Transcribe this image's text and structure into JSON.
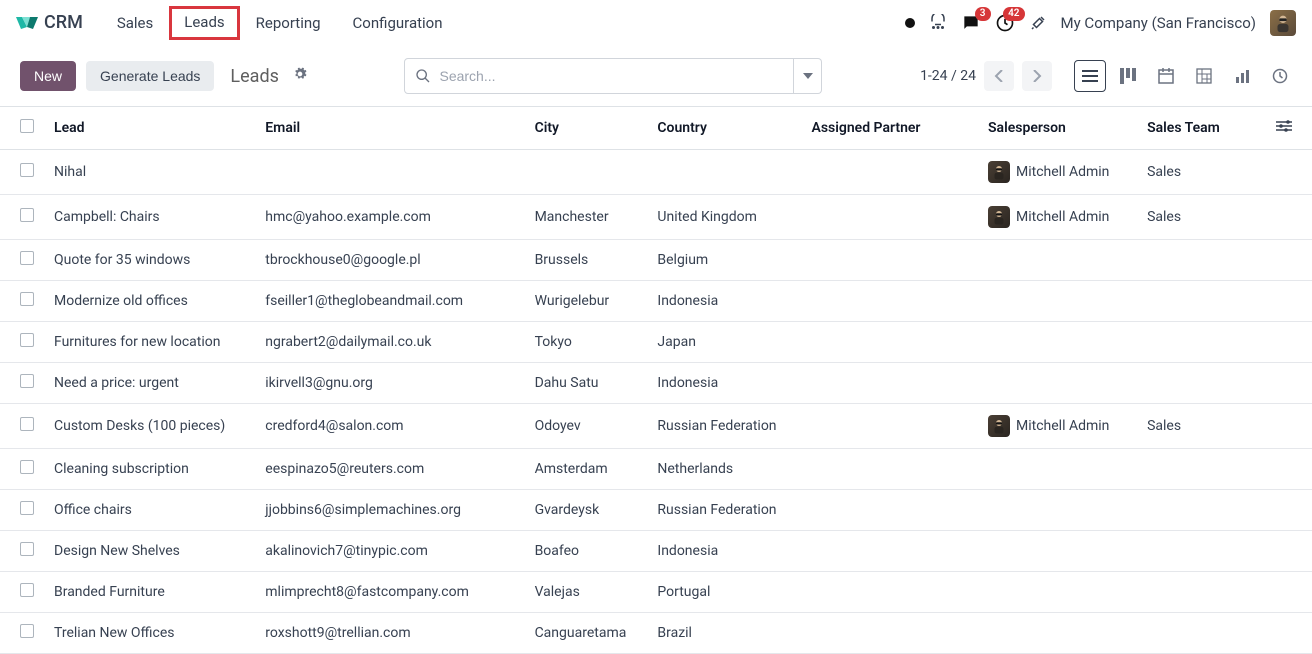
{
  "app": {
    "title": "CRM"
  },
  "nav": {
    "items": [
      {
        "label": "Sales"
      },
      {
        "label": "Leads"
      },
      {
        "label": "Reporting"
      },
      {
        "label": "Configuration"
      }
    ]
  },
  "topbar": {
    "messages_badge": "3",
    "activities_badge": "42",
    "company": "My Company (San Francisco)"
  },
  "controls": {
    "new_label": "New",
    "generate_label": "Generate Leads",
    "breadcrumb": "Leads",
    "search_placeholder": "Search...",
    "pager": "1-24 / 24"
  },
  "table": {
    "headers": {
      "lead": "Lead",
      "email": "Email",
      "city": "City",
      "country": "Country",
      "partner": "Assigned Partner",
      "salesperson": "Salesperson",
      "team": "Sales Team"
    },
    "rows": [
      {
        "lead": "Nihal",
        "email": "",
        "city": "",
        "country": "",
        "partner": "",
        "salesperson": "Mitchell Admin",
        "team": "Sales"
      },
      {
        "lead": "Campbell: Chairs",
        "email": "hmc@yahoo.example.com",
        "city": "Manchester",
        "country": "United Kingdom",
        "partner": "",
        "salesperson": "Mitchell Admin",
        "team": "Sales"
      },
      {
        "lead": "Quote for 35 windows",
        "email": "tbrockhouse0@google.pl",
        "city": "Brussels",
        "country": "Belgium",
        "partner": "",
        "salesperson": "",
        "team": ""
      },
      {
        "lead": "Modernize old offices",
        "email": "fseiller1@theglobeandmail.com",
        "city": "Wurigelebur",
        "country": "Indonesia",
        "partner": "",
        "salesperson": "",
        "team": ""
      },
      {
        "lead": "Furnitures for new location",
        "email": "ngrabert2@dailymail.co.uk",
        "city": "Tokyo",
        "country": "Japan",
        "partner": "",
        "salesperson": "",
        "team": ""
      },
      {
        "lead": "Need a price: urgent",
        "email": "ikirvell3@gnu.org",
        "city": "Dahu Satu",
        "country": "Indonesia",
        "partner": "",
        "salesperson": "",
        "team": ""
      },
      {
        "lead": "Custom Desks (100 pieces)",
        "email": "credford4@salon.com",
        "city": "Odoyev",
        "country": "Russian Federation",
        "partner": "",
        "salesperson": "Mitchell Admin",
        "team": "Sales"
      },
      {
        "lead": "Cleaning subscription",
        "email": "eespinazo5@reuters.com",
        "city": "Amsterdam",
        "country": "Netherlands",
        "partner": "",
        "salesperson": "",
        "team": ""
      },
      {
        "lead": "Office chairs",
        "email": "jjobbins6@simplemachines.org",
        "city": "Gvardeysk",
        "country": "Russian Federation",
        "partner": "",
        "salesperson": "",
        "team": ""
      },
      {
        "lead": "Design New Shelves",
        "email": "akalinovich7@tinypic.com",
        "city": "Boafeo",
        "country": "Indonesia",
        "partner": "",
        "salesperson": "",
        "team": ""
      },
      {
        "lead": "Branded Furniture",
        "email": "mlimprecht8@fastcompany.com",
        "city": "Valejas",
        "country": "Portugal",
        "partner": "",
        "salesperson": "",
        "team": ""
      },
      {
        "lead": "Trelian New Offices",
        "email": "roxshott9@trellian.com",
        "city": "Canguaretama",
        "country": "Brazil",
        "partner": "",
        "salesperson": "",
        "team": ""
      }
    ]
  }
}
